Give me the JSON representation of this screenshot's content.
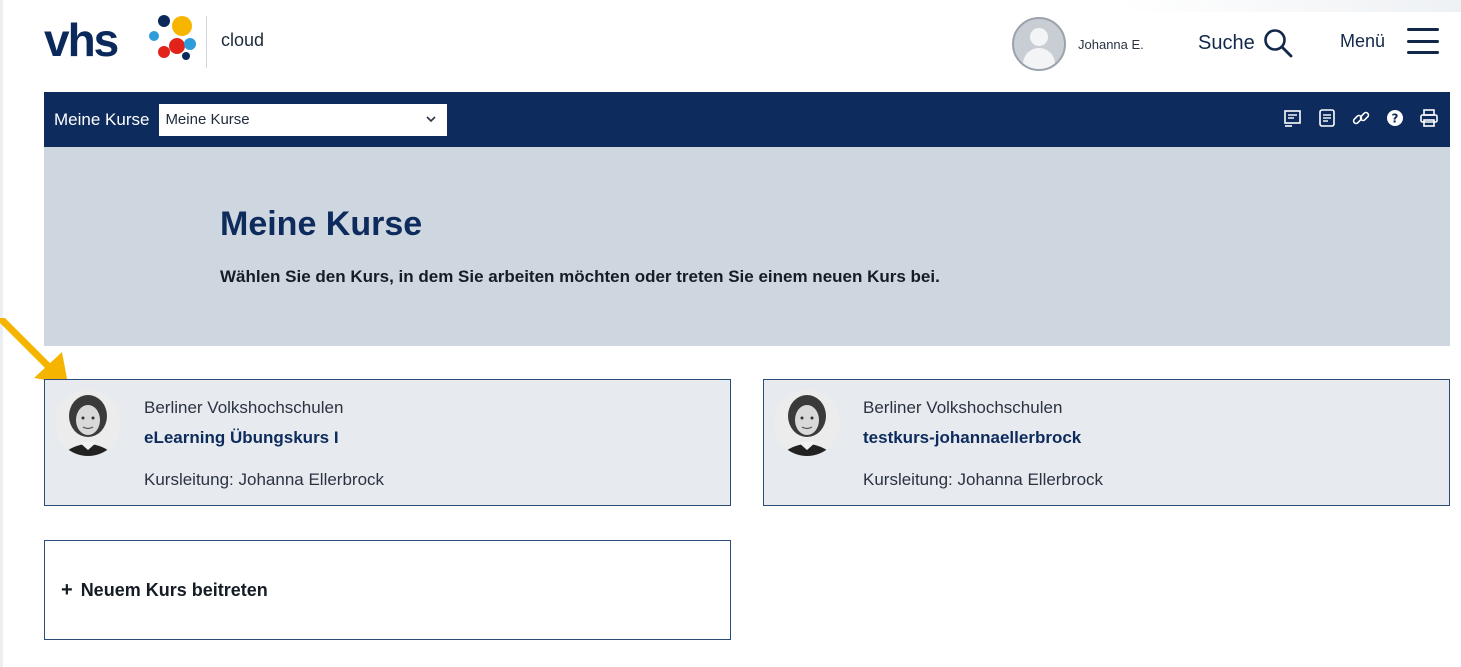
{
  "header": {
    "logo_text": "vhs",
    "logo_colors": [
      "#0b2a5b",
      "#f7b500",
      "#e2231a",
      "#2d9cdb"
    ],
    "product_label": "cloud",
    "user_name": "Johanna E.",
    "search_label": "Suche",
    "menu_label": "Menü"
  },
  "navbar": {
    "label": "Meine Kurse",
    "select_value": "Meine Kurse",
    "icons": [
      "feed-icon",
      "notes-icon",
      "link-icon",
      "help-icon",
      "print-icon"
    ],
    "background": "#0d2b5c"
  },
  "hero": {
    "title": "Meine Kurse",
    "subtitle": "Wählen Sie den Kurs, in dem Sie arbeiten möchten oder treten Sie einem neuen Kurs bei."
  },
  "courses": [
    {
      "organization": "Berliner Volkshochschulen",
      "title": "eLearning Übungskurs I",
      "teacher": "Kursleitung: Johanna Ellerbrock"
    },
    {
      "organization": "Berliner Volkshochschulen",
      "title": "testkurs-johannaellerbrock",
      "teacher": "Kursleitung: Johanna Ellerbrock"
    }
  ],
  "join": {
    "plus": "+",
    "label": "Neuem Kurs beitreten"
  },
  "annotation": {
    "arrow_color": "#f5b400"
  }
}
